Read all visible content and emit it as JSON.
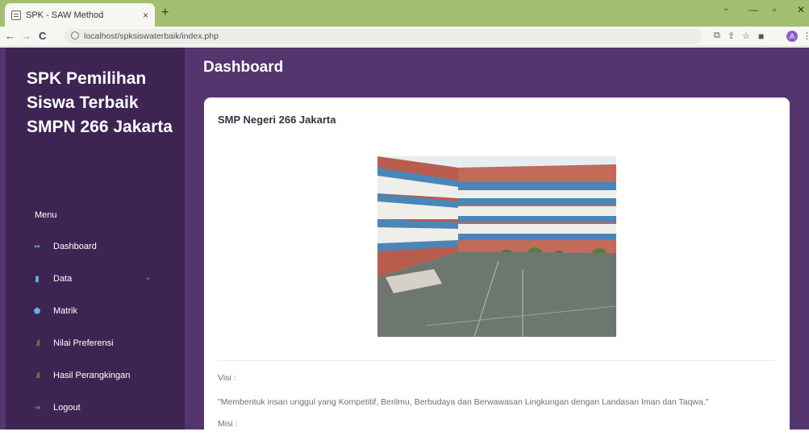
{
  "browser": {
    "tab_title": "SPK - SAW Method",
    "tab_close": "×",
    "new_tab": "+",
    "url": "localhost/spksiswaterbaik/index.php",
    "profile_initial": "A",
    "win_minimize": "—",
    "win_maximize": "▫",
    "win_close": "✕",
    "chevron_down": "⌄"
  },
  "sidebar": {
    "brand": "SPK Pemilihan Siswa Terbaik SMPN 266 Jakarta",
    "menu_heading": "Menu",
    "items": [
      {
        "label": "Dashboard",
        "icon": "grid-icon"
      },
      {
        "label": "Data",
        "icon": "file-icon"
      },
      {
        "label": "Matrik",
        "icon": "pentagon-icon"
      },
      {
        "label": "Nilai Preferensi",
        "icon": "bar-chart-icon"
      },
      {
        "label": "Hasil Perangkingan",
        "icon": "bar-chart-icon"
      },
      {
        "label": "Logout",
        "icon": "logout-icon"
      }
    ]
  },
  "main": {
    "page_title": "Dashboard",
    "card": {
      "title": "SMP Negeri 266 Jakarta",
      "visi_label": "Visi :",
      "visi_text": "\"Membentuk insan unggul yang Kompetitif, Berilmu, Berbudaya dan Berwawasan Lingkungan dengan Landasan Iman dan Taqwa.\"",
      "misi_label": "Misi :"
    }
  },
  "colors": {
    "tabbar": "#a4bf6f",
    "sidebar": "#3d2452",
    "main_bg": "#54356e",
    "card": "#ffffff"
  }
}
